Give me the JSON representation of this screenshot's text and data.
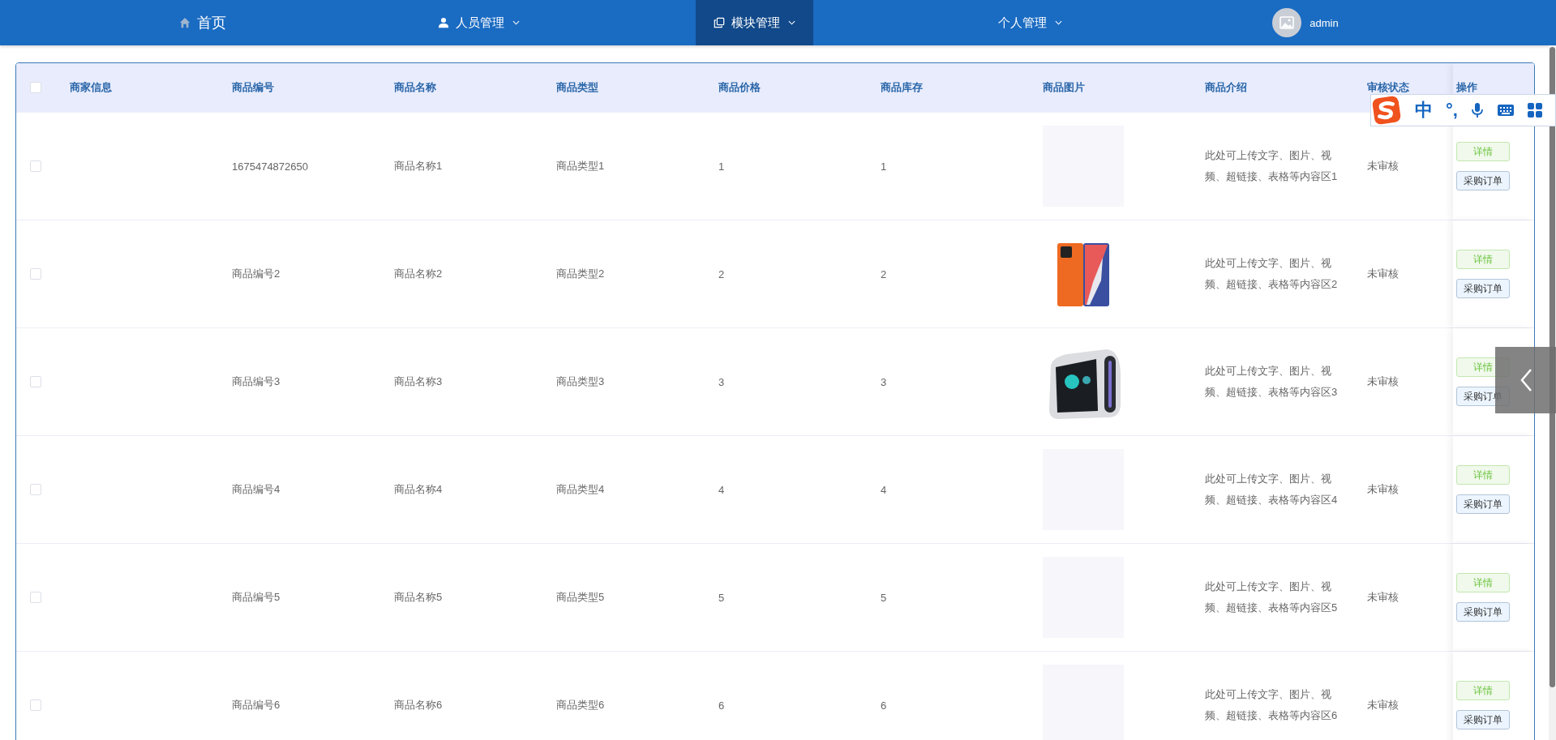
{
  "nav": {
    "items": [
      {
        "label": "首页",
        "dropdown": false,
        "selected": false
      },
      {
        "label": "人员管理",
        "dropdown": true,
        "selected": false
      },
      {
        "label": "模块管理",
        "dropdown": true,
        "selected": true
      },
      {
        "label": "个人管理",
        "dropdown": true,
        "selected": false
      }
    ],
    "user": {
      "name": "admin"
    }
  },
  "table": {
    "all_checked": false,
    "columns": [
      "商家信息",
      "商品编号",
      "商品名称",
      "商品类型",
      "商品价格",
      "商品库存",
      "商品图片",
      "商品介绍",
      "审核状态",
      "操作"
    ],
    "rows": [
      {
        "selected": false,
        "code": "1675474872650",
        "name": "商品名称1",
        "type": "商品类型1",
        "price": "1",
        "stock": "1",
        "image": {
          "kind": "empty"
        },
        "intro": "此处可上传文字、图片、视频、超链接、表格等内容区1",
        "status": "未审核",
        "actions": [
          "详情",
          "采购订单"
        ]
      },
      {
        "selected": false,
        "code": "商品编号2",
        "name": "商品名称2",
        "type": "商品类型2",
        "price": "2",
        "stock": "2",
        "intro": "此处可上传文字、图片、视频、超链接、表格等内容区2",
        "status": "未审核",
        "actions": [
          "详情",
          "采购订单"
        ]
      },
      {
        "selected": false,
        "code": "商品编号3",
        "name": "商品名称3",
        "type": "商品类型3",
        "price": "3",
        "stock": "3",
        "intro": "此处可上传文字、图片、视频、超链接、表格等内容区3",
        "status": "未审核",
        "actions": [
          "详情",
          "采购订单"
        ]
      },
      {
        "selected": false,
        "code": "商品编号4",
        "name": "商品名称4",
        "type": "商品类型4",
        "price": "4",
        "stock": "4",
        "image": {
          "kind": "empty"
        },
        "intro": "此处可上传文字、图片、视频、超链接、表格等内容区4",
        "status": "未审核",
        "actions": [
          "详情",
          "采购订单"
        ]
      },
      {
        "selected": false,
        "code": "商品编号5",
        "name": "商品名称5",
        "type": "商品类型5",
        "price": "5",
        "stock": "5",
        "image": {
          "kind": "empty"
        },
        "intro": "此处可上传文字、图片、视频、超链接、表格等内容区5",
        "status": "未审核",
        "actions": [
          "详情",
          "采购订单"
        ]
      },
      {
        "selected": false,
        "code": "商品编号6",
        "name": "商品名称6",
        "type": "商品类型6",
        "price": "6",
        "stock": "6",
        "image": {
          "kind": "empty"
        },
        "intro": "此处可上传文字、图片、视频、超链接、表格等内容区6",
        "status": "未审核",
        "actions": [
          "详情",
          "采购订单"
        ]
      }
    ]
  },
  "ime_toolbar": {
    "mode": "中",
    "punctuation": "°,"
  }
}
